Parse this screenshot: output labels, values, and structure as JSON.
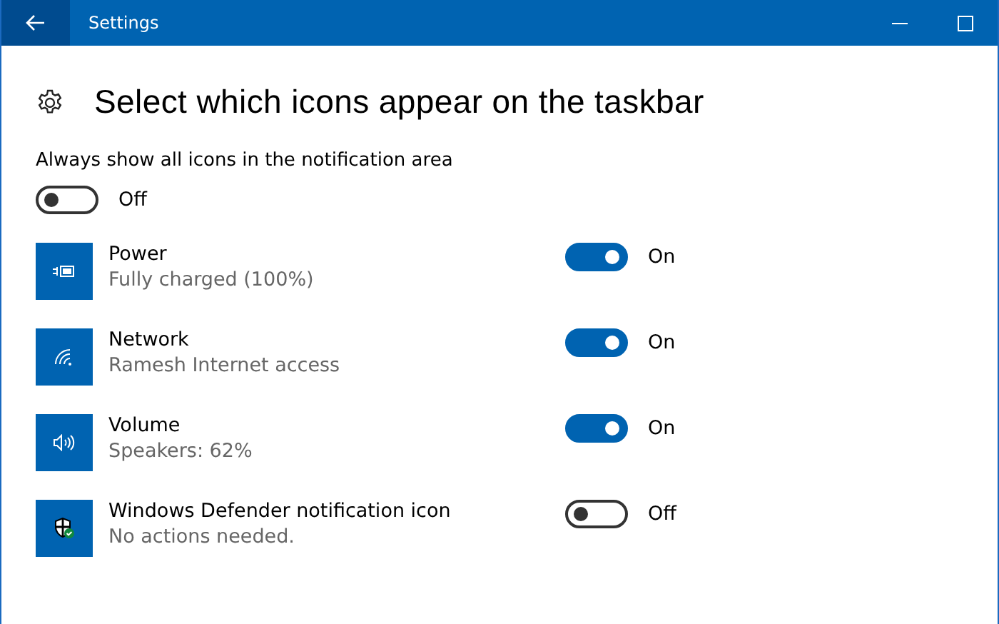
{
  "window": {
    "title": "Settings"
  },
  "heading": "Select which icons appear on the taskbar",
  "always_show": {
    "label": "Always show all icons in the notification area",
    "on": false,
    "state_text": "Off"
  },
  "items": [
    {
      "name": "Power",
      "status": "Fully charged (100%)",
      "on": true,
      "state_text": "On"
    },
    {
      "name": "Network",
      "status": "Ramesh Internet access",
      "on": true,
      "state_text": "On"
    },
    {
      "name": "Volume",
      "status": "Speakers: 62%",
      "on": true,
      "state_text": "On"
    },
    {
      "name": "Windows Defender notification icon",
      "status": "No actions needed.",
      "on": false,
      "state_text": "Off"
    }
  ]
}
